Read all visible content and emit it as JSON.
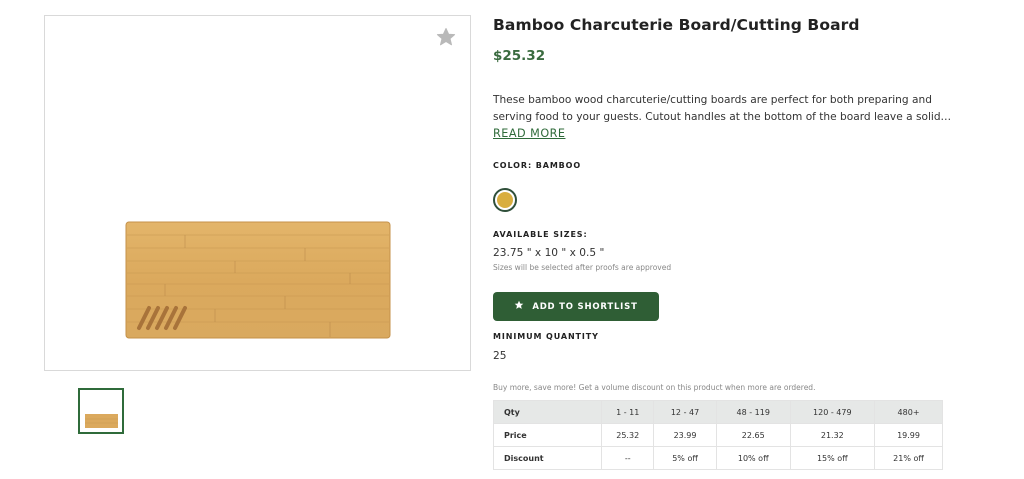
{
  "product": {
    "title": "Bamboo Charcuterie Board/Cutting Board",
    "price": "$25.32",
    "description_line1": "These bamboo wood charcuterie/cutting boards are perfect for both preparing and",
    "description_line2": "serving food to your guests. Cutout handles at the bottom of the board leave a solid…",
    "read_more": "READ MORE"
  },
  "color": {
    "label": "COLOR: BAMBOO",
    "swatch_hex": "#d9ae3f",
    "swatch_name": "Bamboo"
  },
  "sizes": {
    "label": "AVAILABLE SIZES:",
    "value": "23.75 \" x 10 \" x 0.5 \"",
    "note": "Sizes will be selected after proofs are approved"
  },
  "actions": {
    "shortlist_label": "ADD TO SHORTLIST",
    "shortlist_icon": "star-icon",
    "favorite_icon": "star-icon"
  },
  "minimum": {
    "label": "MINIMUM QUANTITY",
    "value": "25"
  },
  "pricing": {
    "promo": "Buy more, save more! Get a volume discount on this product when more are ordered.",
    "header": [
      "Qty",
      "1 - 11",
      "12 - 47",
      "48 - 119",
      "120 - 479",
      "480+"
    ],
    "rows": [
      [
        "Price",
        "25.32",
        "23.99",
        "22.65",
        "21.32",
        "19.99"
      ],
      [
        "Discount",
        "--",
        "5% off",
        "10% off",
        "15% off",
        "21% off"
      ]
    ]
  },
  "colors": {
    "brand_green": "#2f5e35",
    "price_green": "#3a6b3f",
    "bamboo": "#d9ae3f"
  }
}
